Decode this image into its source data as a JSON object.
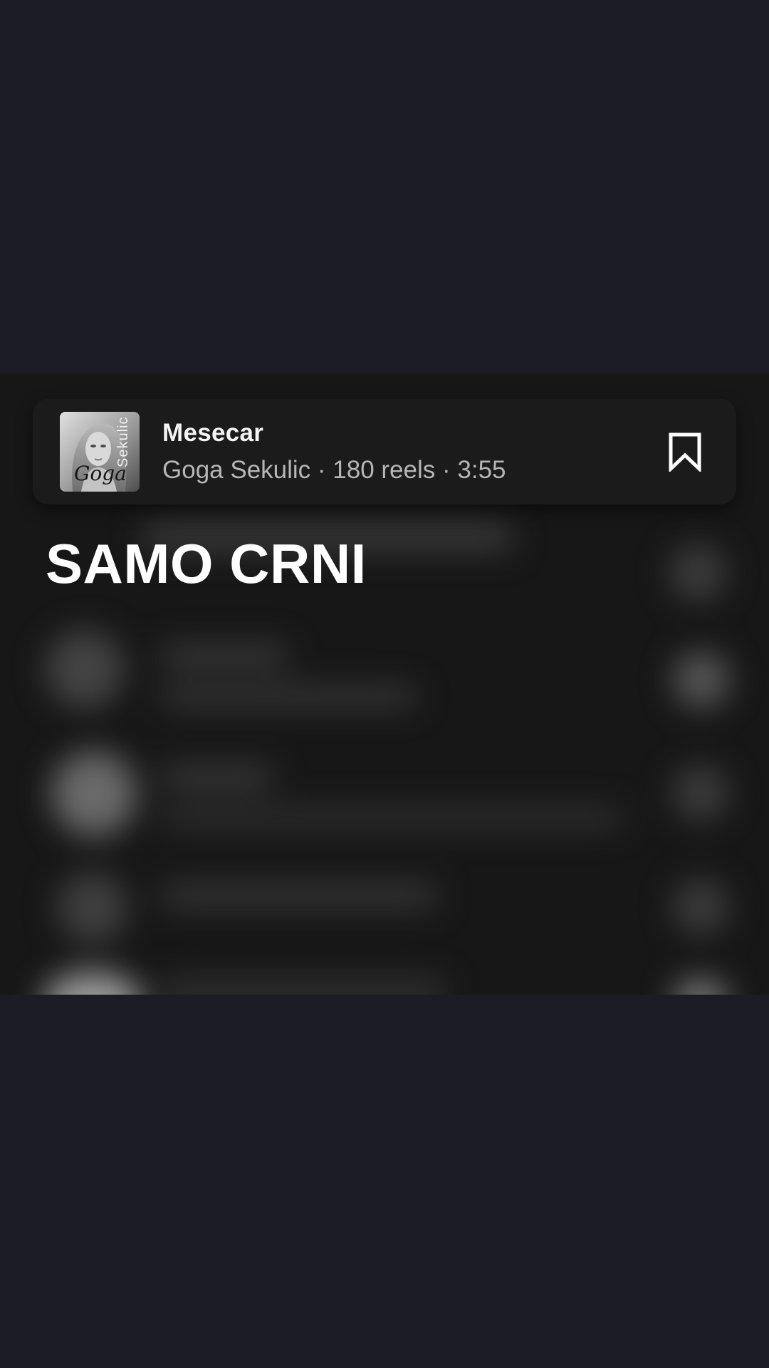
{
  "music": {
    "title": "Mesecar",
    "artist": "Goga Sekulic",
    "reels": "180 reels",
    "duration": "3:55",
    "separator": " · ",
    "album_art_script": "Goga",
    "album_art_side": "Sekulic"
  },
  "overlay": {
    "headline": "SAMO CRNI"
  },
  "icons": {
    "bookmark": "bookmark-outline-icon"
  },
  "colors": {
    "background": "#1b1c24",
    "reel_background": "#171717",
    "card": "#1b1b1b",
    "text_primary": "#f4f4f4",
    "text_secondary": "#b6b6b6"
  }
}
